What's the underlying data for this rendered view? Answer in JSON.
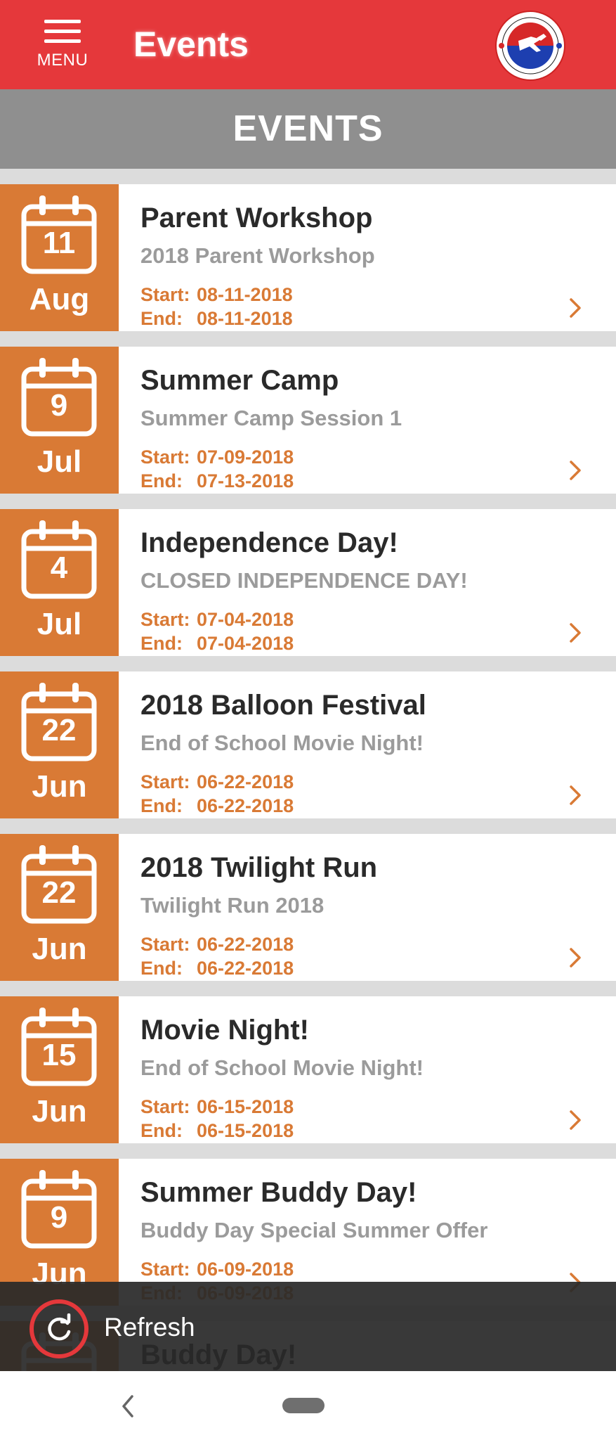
{
  "appbar": {
    "menu_label": "MENU",
    "title": "Events"
  },
  "section": {
    "title": "EVENTS"
  },
  "labels": {
    "start": "Start:",
    "end": "End:"
  },
  "events": [
    {
      "day": "11",
      "month": "Aug",
      "title": "Parent Workshop",
      "subtitle": "2018 Parent Workshop",
      "start": "08-11-2018",
      "end": "08-11-2018"
    },
    {
      "day": "9",
      "month": "Jul",
      "title": "Summer Camp",
      "subtitle": "Summer Camp Session 1",
      "start": "07-09-2018",
      "end": "07-13-2018"
    },
    {
      "day": "4",
      "month": "Jul",
      "title": "Independence Day!",
      "subtitle": "CLOSED INDEPENDENCE DAY!",
      "start": "07-04-2018",
      "end": "07-04-2018"
    },
    {
      "day": "22",
      "month": "Jun",
      "title": "2018 Balloon Festival",
      "subtitle": "End of School Movie Night!",
      "start": "06-22-2018",
      "end": "06-22-2018"
    },
    {
      "day": "22",
      "month": "Jun",
      "title": "2018 Twilight Run",
      "subtitle": "Twilight Run 2018",
      "start": "06-22-2018",
      "end": "06-22-2018"
    },
    {
      "day": "15",
      "month": "Jun",
      "title": "Movie Night!",
      "subtitle": "End of School Movie Night!",
      "start": "06-15-2018",
      "end": "06-15-2018"
    },
    {
      "day": "9",
      "month": "Jun",
      "title": "Summer Buddy Day!",
      "subtitle": "Buddy Day Special Summer Offer",
      "start": "06-09-2018",
      "end": "06-09-2018"
    },
    {
      "day": "",
      "month": "",
      "title": "Buddy Day!",
      "subtitle": "",
      "start": "",
      "end": ""
    }
  ],
  "snackbar": {
    "text": "Refresh",
    "icon": "refresh-icon"
  },
  "colors": {
    "appbar": "#e5383b",
    "header": "#8f8f8f",
    "accent": "#d97a35"
  },
  "icons": [
    "menu-icon",
    "logo",
    "calendar-icon",
    "chevron-right-icon",
    "refresh-icon",
    "back-icon",
    "home-pill"
  ]
}
